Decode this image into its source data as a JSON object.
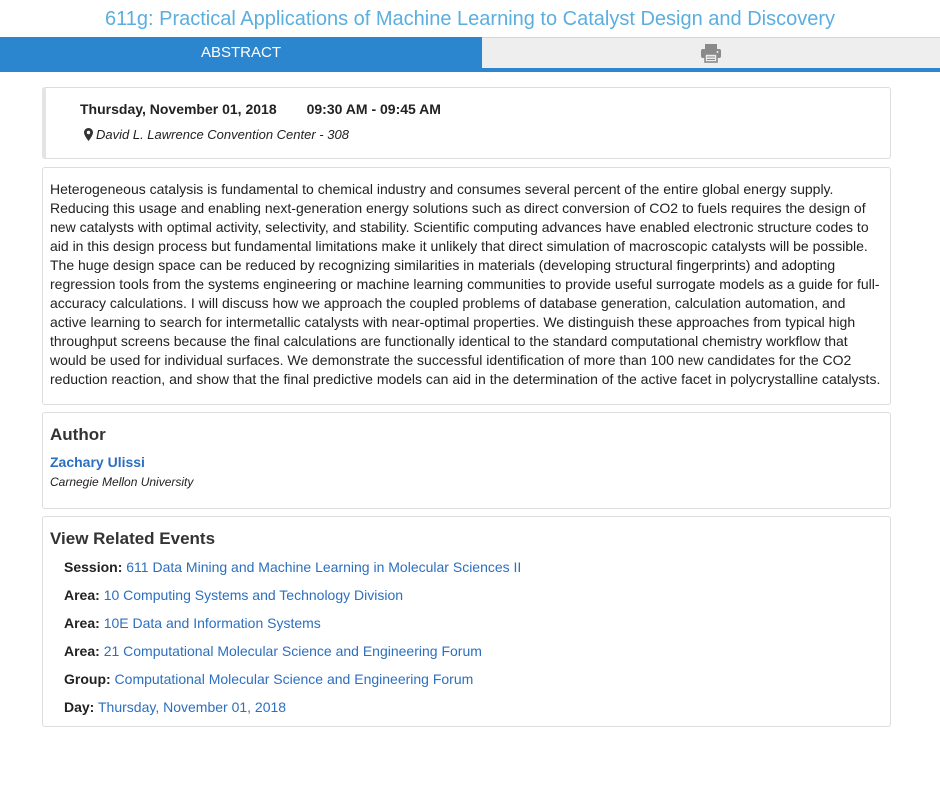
{
  "page": {
    "title": "611g: Practical Applications of Machine Learning to Catalyst Design and Discovery"
  },
  "tabs": {
    "abstract_label": "ABSTRACT",
    "print_icon": "printer-icon"
  },
  "colors": {
    "accent": "#2c85cf",
    "title": "#5aaee0",
    "link": "#2c6fbf"
  },
  "event": {
    "date": "Thursday, November 01, 2018",
    "time_range": "09:30 AM - 09:45 AM",
    "location": "David L. Lawrence Convention Center - 308",
    "location_icon": "map-pin-icon"
  },
  "abstract": {
    "text": "Heterogeneous catalysis is fundamental to chemical industry and consumes several percent of the entire global energy supply. Reducing this usage and enabling next-generation energy solutions such as direct conversion of CO2 to fuels requires the design of new catalysts with optimal activity, selectivity, and stability. Scientific computing advances have enabled electronic structure codes to aid in this design process but fundamental limitations make it unlikely that direct simulation of macroscopic catalysts will be possible. The huge design space can be reduced by recognizing similarities in materials (developing structural fingerprints) and adopting regression tools from the systems engineering or machine learning communities to provide useful surrogate models as a guide for full-accuracy calculations. I will discuss how we approach the coupled problems of database generation, calculation automation, and active learning to search for intermetallic catalysts with near-optimal properties. We distinguish these approaches from typical high throughput screens because the final calculations are functionally identical to the standard computational chemistry workflow that would be used for individual surfaces. We demonstrate the successful identification of more than 100 new candidates for the CO2 reduction reaction, and show that the final predictive models can aid in the determination of the active facet in polycrystalline catalysts."
  },
  "author": {
    "heading": "Author",
    "name": "Zachary Ulissi",
    "affiliation": "Carnegie Mellon University"
  },
  "related": {
    "heading": "View Related Events",
    "items": [
      {
        "key": "Session:",
        "value": "611 Data Mining and Machine Learning in Molecular Sciences II"
      },
      {
        "key": "Area:",
        "value": "10 Computing Systems and Technology Division"
      },
      {
        "key": "Area:",
        "value": "10E Data and Information Systems"
      },
      {
        "key": "Area:",
        "value": "21 Computational Molecular Science and Engineering Forum"
      },
      {
        "key": "Group:",
        "value": "Computational Molecular Science and Engineering Forum"
      },
      {
        "key": "Day:",
        "value": "Thursday, November 01, 2018"
      }
    ]
  }
}
